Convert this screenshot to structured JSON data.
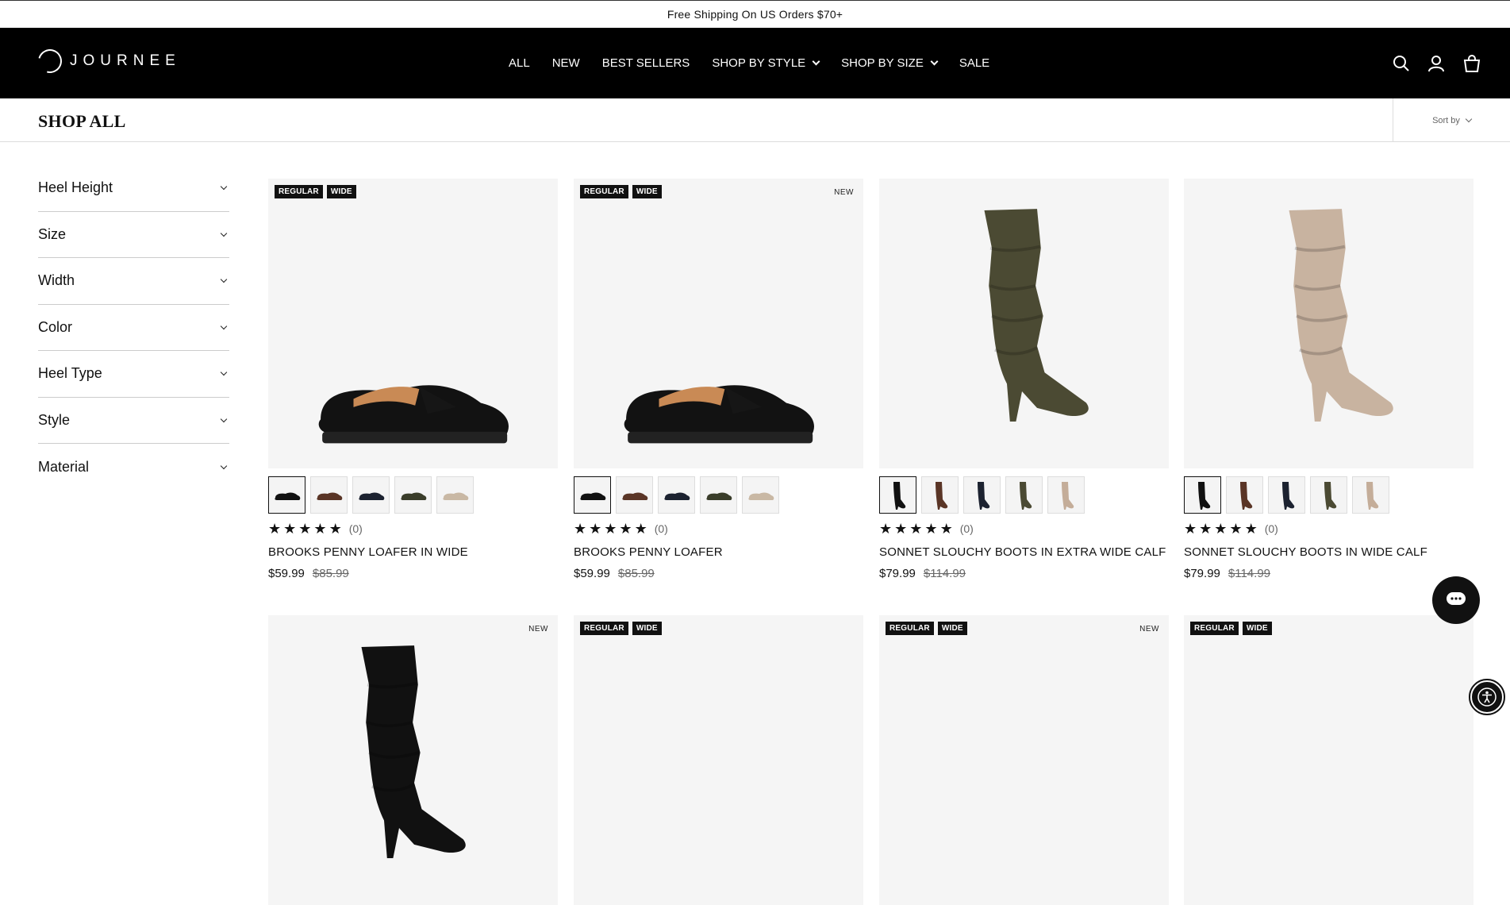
{
  "announcement": "Free Shipping On US Orders $70+",
  "brand": "JOURNEE",
  "nav": [
    {
      "label": "ALL",
      "has_dropdown": false
    },
    {
      "label": "NEW",
      "has_dropdown": false
    },
    {
      "label": "BEST SELLERS",
      "has_dropdown": false
    },
    {
      "label": "SHOP BY STYLE",
      "has_dropdown": true
    },
    {
      "label": "SHOP BY SIZE",
      "has_dropdown": true
    },
    {
      "label": "SALE",
      "has_dropdown": false
    }
  ],
  "header_icons": [
    "search-icon",
    "account-icon",
    "cart-icon"
  ],
  "page_title": "SHOP ALL",
  "sort_label": "Sort by",
  "filters": [
    "Heel Height",
    "Size",
    "Width",
    "Color",
    "Heel Type",
    "Style",
    "Material"
  ],
  "products": [
    {
      "name": "BROOKS PENNY LOAFER IN WIDE",
      "price": "$59.99",
      "compare_price": "$85.99",
      "rating_count": "(0)",
      "badges": [
        "REGULAR",
        "WIDE"
      ],
      "new_tag": "",
      "image": "loafer",
      "swatch_colors": [
        "#111111",
        "#5a3526",
        "#1c2230",
        "#3a3d2a",
        "#c9b8a4"
      ]
    },
    {
      "name": "BROOKS PENNY LOAFER",
      "price": "$59.99",
      "compare_price": "$85.99",
      "rating_count": "(0)",
      "badges": [
        "REGULAR",
        "WIDE"
      ],
      "new_tag": "NEW",
      "image": "loafer",
      "swatch_colors": [
        "#111111",
        "#5a3526",
        "#1c2230",
        "#3a3d2a",
        "#c9b8a4"
      ]
    },
    {
      "name": "SONNET SLOUCHY BOOTS IN EXTRA WIDE CALF",
      "price": "$79.99",
      "compare_price": "$114.99",
      "rating_count": "(0)",
      "badges": [],
      "new_tag": "",
      "image": "boot-olive",
      "swatch_colors": [
        "#111111",
        "#5a3526",
        "#1c2230",
        "#4b4a33",
        "#c4ad99"
      ]
    },
    {
      "name": "SONNET SLOUCHY BOOTS IN WIDE CALF",
      "price": "$79.99",
      "compare_price": "$114.99",
      "rating_count": "(0)",
      "badges": [],
      "new_tag": "",
      "image": "boot-taupe",
      "swatch_colors": [
        "#111111",
        "#5a3526",
        "#1c2230",
        "#4b4a33",
        "#c4ad99"
      ]
    }
  ],
  "row2": [
    {
      "badges": [],
      "new_tag": "NEW",
      "image": "boot-black"
    },
    {
      "badges": [
        "REGULAR",
        "WIDE"
      ],
      "new_tag": "",
      "image": ""
    },
    {
      "badges": [
        "REGULAR",
        "WIDE"
      ],
      "new_tag": "NEW",
      "image": ""
    },
    {
      "badges": [
        "REGULAR",
        "WIDE"
      ],
      "new_tag": "",
      "image": ""
    }
  ]
}
